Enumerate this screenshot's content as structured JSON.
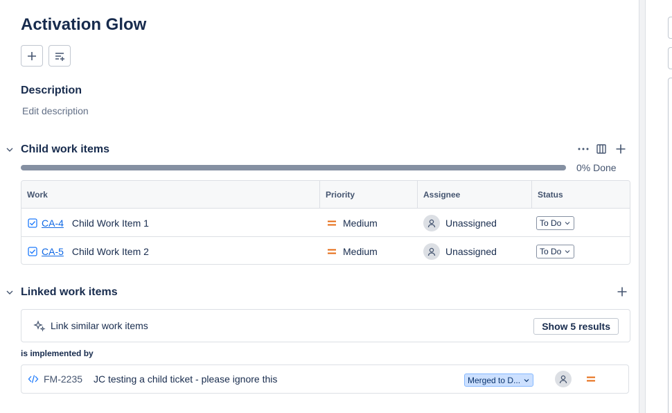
{
  "issue": {
    "title": "Activation Glow"
  },
  "description": {
    "label": "Description",
    "placeholder": "Edit description"
  },
  "child_items": {
    "label": "Child work items",
    "progress_text": "0% Done",
    "progress": 0,
    "columns": [
      "Work",
      "Priority",
      "Assignee",
      "Status"
    ],
    "rows": [
      {
        "key": "CA-4",
        "summary": "Child Work Item 1",
        "priority": "Medium",
        "assignee": "Unassigned",
        "status": "To Do"
      },
      {
        "key": "CA-5",
        "summary": "Child Work Item 2",
        "priority": "Medium",
        "assignee": "Unassigned",
        "status": "To Do"
      }
    ]
  },
  "linked_items": {
    "label": "Linked work items",
    "suggest_text": "Link similar work items",
    "show_button": "Show 5 results",
    "relation_label": "is implemented by",
    "items": [
      {
        "key": "FM-2235",
        "summary": "JC testing a child ticket - please ignore this",
        "status": "Merged to D..."
      }
    ]
  },
  "colors": {
    "link": "#0c66e4",
    "priority_medium": "#e56910",
    "progress_track": "#8590a2",
    "badge_bg": "#cce0ff"
  }
}
